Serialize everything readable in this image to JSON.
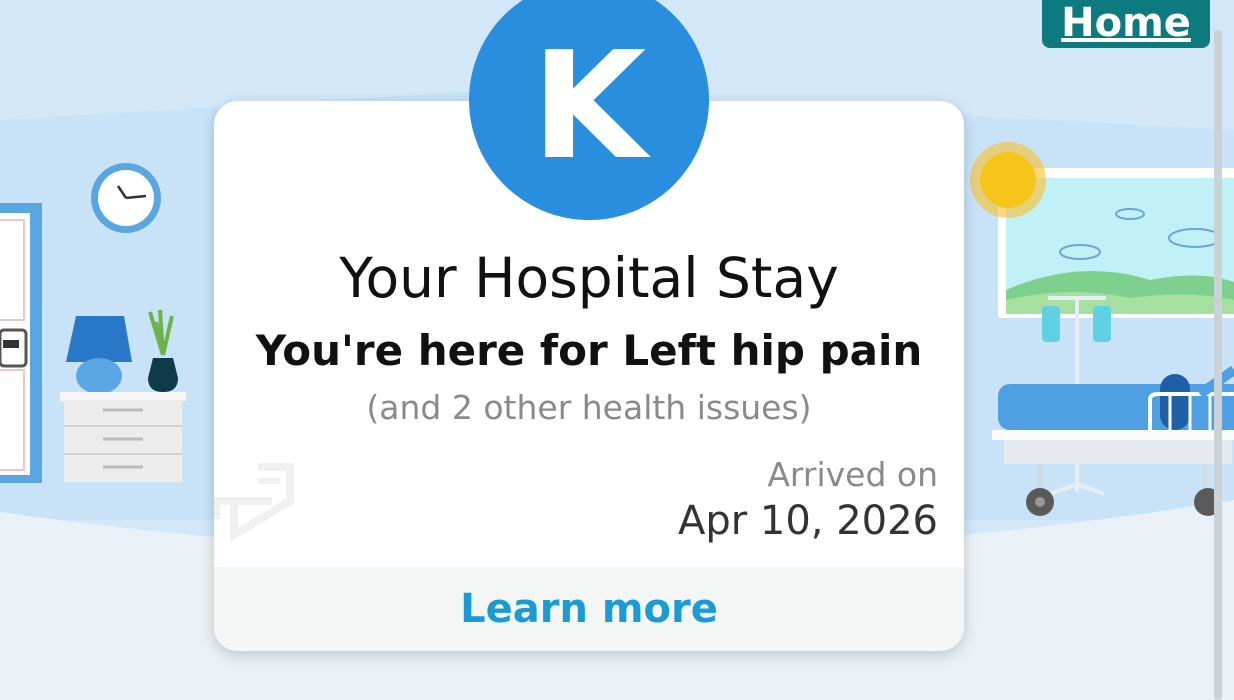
{
  "header": {
    "home_label": "Home"
  },
  "stay_card": {
    "avatar_letter": "K",
    "title": "Your Hospital Stay",
    "reason": "You're here for Left hip pain",
    "other_issues": "(and 2 other health issues)",
    "arrived_label": "Arrived on",
    "arrived_date": "Apr 10, 2026",
    "learn_more_label": "Learn more"
  },
  "colors": {
    "accent": "#1a9bd3",
    "avatar": "#2a8ede",
    "home_button": "#0d7a80"
  },
  "icons": [
    "clock-icon",
    "lamp-icon",
    "plant-icon",
    "nightstand-icon",
    "door-icon",
    "window-icon",
    "sun-icon",
    "iv-stand-icon",
    "hospital-bed-icon",
    "bed-watermark-icon"
  ]
}
